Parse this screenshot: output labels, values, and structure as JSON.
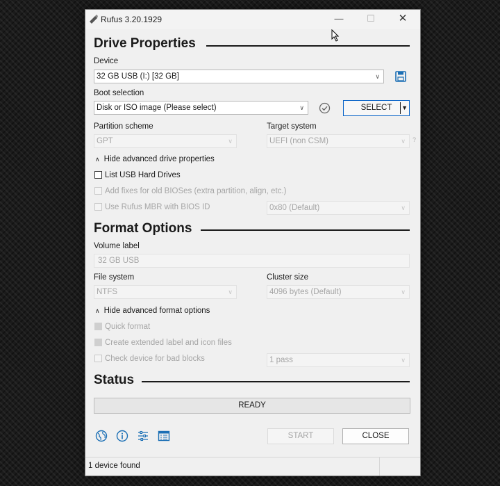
{
  "window": {
    "title": "Rufus 3.20.1929",
    "min_glyph": "—",
    "max_glyph": "☐",
    "close_glyph": "✕"
  },
  "drive_properties": {
    "heading": "Drive Properties",
    "device_label": "Device",
    "device_value": "32 GB USB (I:) [32 GB]",
    "boot_selection_label": "Boot selection",
    "boot_selection_value": "Disk or ISO image (Please select)",
    "select_button": "SELECT",
    "partition_scheme_label": "Partition scheme",
    "partition_scheme_value": "GPT",
    "target_system_label": "Target system",
    "target_system_value": "UEFI (non CSM)",
    "target_help": "?",
    "advanced_toggle": "Hide advanced drive properties",
    "list_usb": "List USB Hard Drives",
    "add_fixes": "Add fixes for old BIOSes (extra partition, align, etc.)",
    "use_mbr": "Use Rufus MBR with BIOS ID",
    "bios_id_value": "0x80 (Default)"
  },
  "format_options": {
    "heading": "Format Options",
    "volume_label_label": "Volume label",
    "volume_label_value": "32 GB USB",
    "file_system_label": "File system",
    "file_system_value": "NTFS",
    "cluster_size_label": "Cluster size",
    "cluster_size_value": "4096 bytes (Default)",
    "advanced_toggle": "Hide advanced format options",
    "quick_format": "Quick format",
    "extended_label": "Create extended label and icon files",
    "bad_blocks": "Check device for bad blocks",
    "passes_value": "1 pass"
  },
  "status": {
    "heading": "Status",
    "progress_text": "READY",
    "start_button": "START",
    "close_button": "CLOSE",
    "footer_text": "1 device found"
  },
  "icons": [
    "language-icon",
    "about-icon",
    "settings-icon",
    "log-icon",
    "save-icon",
    "verify-checksum-icon"
  ],
  "colors": {
    "accent": "#1b6fb5",
    "select_border": "#0a64c8",
    "disabled_text": "#a5a5a5"
  }
}
